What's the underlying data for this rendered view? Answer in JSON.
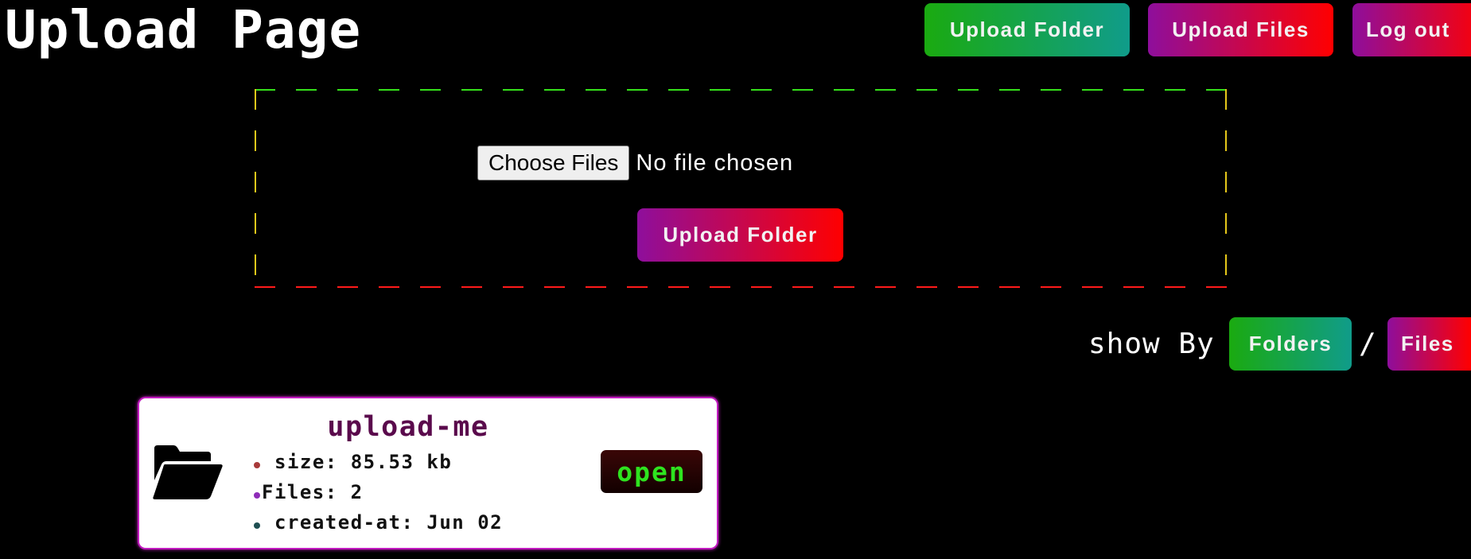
{
  "header": {
    "title": "Upload Page",
    "nav": {
      "upload_folder_label": "Upload Folder",
      "upload_files_label": "Upload Files",
      "logout_label": "Log out"
    }
  },
  "upload_area": {
    "choose_files_label": "Choose Files",
    "file_status": "No file chosen",
    "upload_button_label": "Upload Folder"
  },
  "view_toggle": {
    "label": "show By",
    "separator": "/",
    "folders_label": "Folders",
    "files_label": "Files"
  },
  "folders": [
    {
      "name": "upload-me",
      "size": "size: 85.53 kb",
      "files": "Files: 2",
      "created": "created-at: Jun 02",
      "open_label": "open"
    }
  ],
  "colors": {
    "background": "#000000",
    "green_gradient": [
      "#1aaa10",
      "#109c8a"
    ],
    "pink_gradient": [
      "#8e0e9c",
      "#ff0000"
    ],
    "card_glow": "#c21bc0",
    "folder_name": "#5a0a4c",
    "open_text": "#2ee41f",
    "bullet_size": "#a83a3a",
    "bullet_files": "#8e2cb8",
    "bullet_created": "#1f4f52"
  },
  "icons": {
    "folder": "folder-open-icon"
  }
}
